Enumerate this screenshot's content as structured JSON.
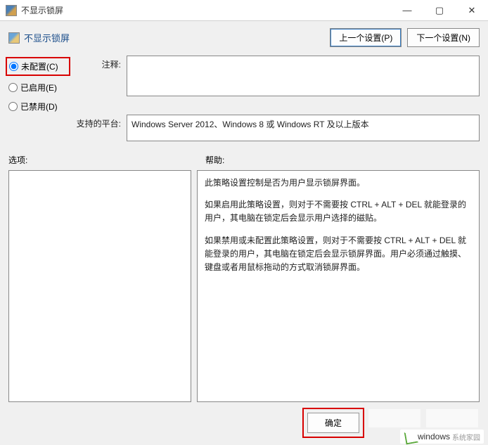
{
  "window": {
    "title": "不显示锁屏"
  },
  "header": {
    "title": "不显示锁屏",
    "prev_button": "上一个设置(P)",
    "next_button": "下一个设置(N)"
  },
  "radios": {
    "not_configured": "未配置(C)",
    "enabled": "已启用(E)",
    "disabled": "已禁用(D)",
    "selected": "not_configured"
  },
  "fields": {
    "comment_label": "注释:",
    "comment_value": "",
    "platform_label": "支持的平台:",
    "platform_value": "Windows Server 2012、Windows 8 或 Windows RT 及以上版本"
  },
  "panels": {
    "options_label": "选项:",
    "help_label": "帮助:"
  },
  "help": {
    "p1": "此策略设置控制是否为用户显示锁屏界面。",
    "p2": "如果启用此策略设置，则对于不需要按 CTRL + ALT + DEL  就能登录的用户，其电脑在锁定后会显示用户选择的磁贴。",
    "p3": "如果禁用或未配置此策略设置，则对于不需要按 CTRL + ALT + DEL 就能登录的用户，其电脑在锁定后会显示锁屏界面。用户必须通过触摸、键盘或者用鼠标拖动的方式取消锁屏界面。"
  },
  "buttons": {
    "ok": "确定"
  },
  "watermark": {
    "text": "windows",
    "sub": "系统家园"
  }
}
